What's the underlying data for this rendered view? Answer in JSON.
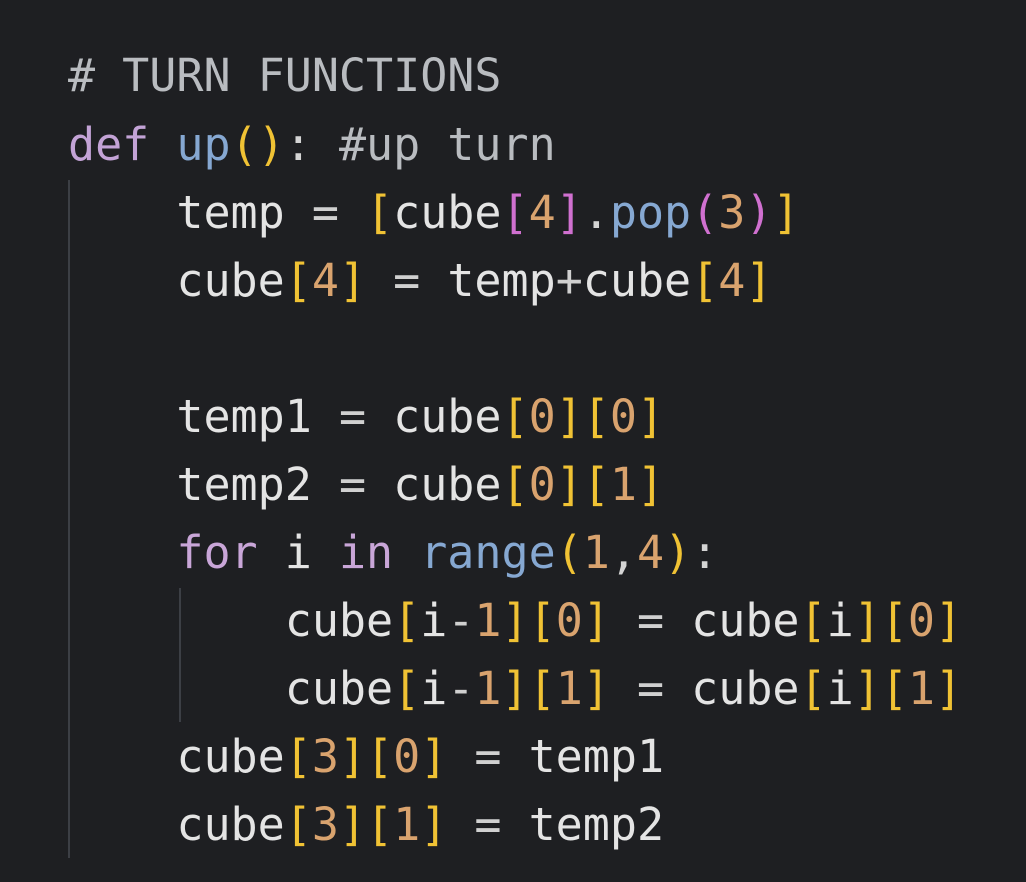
{
  "code_lines": [
    "# TURN FUNCTIONS",
    "def up(): #up turn",
    "    temp = [cube[4].pop(3)]",
    "    cube[4] = temp+cube[4]",
    "",
    "    temp1 = cube[0][0]",
    "    temp2 = cube[0][1]",
    "    for i in range(1,4):",
    "        cube[i-1][0] = cube[i][0]",
    "        cube[i-1][1] = cube[i][1]",
    "    cube[3][0] = temp1",
    "    cube[3][1] = temp2"
  ],
  "tokens": {
    "l0": {
      "comment": "# TURN FUNCTIONS"
    },
    "l1": {
      "def": "def",
      "name": "up",
      "open": "(",
      "close": ")",
      "colon": ":",
      "comment": "#up turn"
    },
    "l2": {
      "var": "temp",
      "eq": "=",
      "lb": "[",
      "cube": "cube",
      "ib_open": "[",
      "idx": "4",
      "ib_close": "]",
      "dot": ".",
      "method": "pop",
      "po": "(",
      "arg": "3",
      "pc": ")",
      "rb": "]"
    },
    "l3": {
      "cube": "cube",
      "ib_open": "[",
      "idx": "4",
      "ib_close": "]",
      "eq": "=",
      "temp": "temp",
      "plus": "+",
      "cube2": "cube",
      "ib2_open": "[",
      "idx2": "4",
      "ib2_close": "]"
    },
    "l5": {
      "var": "temp1",
      "eq": "=",
      "cube": "cube",
      "a_open": "[",
      "a": "0",
      "a_close": "]",
      "b_open": "[",
      "b": "0",
      "b_close": "]"
    },
    "l6": {
      "var": "temp2",
      "eq": "=",
      "cube": "cube",
      "a_open": "[",
      "a": "0",
      "a_close": "]",
      "b_open": "[",
      "b": "1",
      "b_close": "]"
    },
    "l7": {
      "for": "for",
      "i": "i",
      "in": "in",
      "range": "range",
      "po": "(",
      "start": "1",
      "comma": ",",
      "end": "4",
      "pc": ")",
      "colon": ":"
    },
    "l8": {
      "cube": "cube",
      "a_open": "[",
      "a_var": "i",
      "a_op": "-",
      "a_num": "1",
      "a_close": "]",
      "b_open": "[",
      "b": "0",
      "b_close": "]",
      "eq": "=",
      "cube2": "cube",
      "c_open": "[",
      "c": "i",
      "c_close": "]",
      "d_open": "[",
      "d": "0",
      "d_close": "]"
    },
    "l9": {
      "cube": "cube",
      "a_open": "[",
      "a_var": "i",
      "a_op": "-",
      "a_num": "1",
      "a_close": "]",
      "b_open": "[",
      "b": "1",
      "b_close": "]",
      "eq": "=",
      "cube2": "cube",
      "c_open": "[",
      "c": "i",
      "c_close": "]",
      "d_open": "[",
      "d": "1",
      "d_close": "]"
    },
    "l10": {
      "cube": "cube",
      "a_open": "[",
      "a": "3",
      "a_close": "]",
      "b_open": "[",
      "b": "0",
      "b_close": "]",
      "eq": "=",
      "var": "temp1"
    },
    "l11": {
      "cube": "cube",
      "a_open": "[",
      "a": "3",
      "a_close": "]",
      "b_open": "[",
      "b": "1",
      "b_close": "]",
      "eq": "=",
      "var": "temp2"
    }
  },
  "theme": {
    "background": "#1e1f22",
    "keyword": "#c3a3d6",
    "function": "#86a8d2",
    "comment": "#b9bcc0",
    "number": "#d9a36e",
    "bracket_gold": "#f0c234",
    "bracket_purple": "#d070d0",
    "bracket_blue": "#4fa8e8"
  }
}
